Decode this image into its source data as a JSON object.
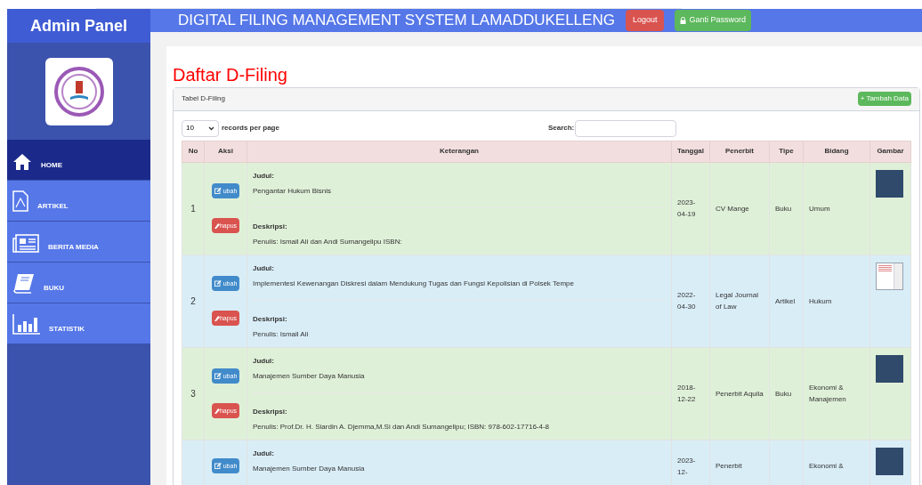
{
  "sidebar": {
    "title": "Admin Panel",
    "items": [
      {
        "label": "HOME",
        "selected": true
      },
      {
        "label": "ARTIKEL",
        "selected": false
      },
      {
        "label": "BERITA MEDIA",
        "selected": false
      },
      {
        "label": "BUKU",
        "selected": false
      },
      {
        "label": "STATISTIK",
        "selected": false
      }
    ]
  },
  "header": {
    "title": "DIGITAL FILING MANAGEMENT SYSTEM LAMADDUKELLENG",
    "logout": "Logout",
    "change_password": "Ganti Password"
  },
  "page_title": "Daftar D-Filing",
  "panel": {
    "title": "Tabel D-Filing",
    "add_button": "+ Tambah Data",
    "page_size": "10",
    "page_size_label": "records per page",
    "search_label": "Search:"
  },
  "table": {
    "columns": [
      "No",
      "Aksi",
      "Keterangan",
      "Tanggal",
      "Penerbit",
      "Tipe",
      "Bidang",
      "Gambar"
    ],
    "rows": [
      {
        "color": "#dff0d8",
        "no": "1",
        "edit": "ubah",
        "delete": "hapus",
        "title_label": "Judul:",
        "title": "Pengantar Hukum Bisnis",
        "desc_label": "Deskripsi:",
        "desc": "Penulis: Ismail Ali dan Andi Sumangelipu ISBN:",
        "date": "2023-04-19",
        "publisher": "CV Mange",
        "type": "Buku",
        "field": "Umum",
        "kind": "cover"
      },
      {
        "color": "#d9edf7",
        "no": "2",
        "edit": "ubah",
        "delete": "hapus",
        "title_label": "Judul:",
        "title": "Implementesi Kewenangan Diskresi dalam Mendukung Tugas dan Fungsi Kepolisian di Polsek Tempe",
        "desc_label": "Deskripsi:",
        "desc": "Penulis: Ismail Ali",
        "date": "2022-04-30",
        "publisher": "Legal Journal of Law",
        "type": "Artikel",
        "field": "Hukum",
        "kind": "document"
      },
      {
        "color": "#dff0d8",
        "no": "3",
        "edit": "ubah",
        "delete": "hapus",
        "title_label": "Judul:",
        "title": "Manajemen Sumber Daya Manusia",
        "desc_label": "Deskripsi:",
        "desc": "Penulis: Prof.Dr. H. Siardin A. Djemma,M.Si dan Andi Sumangelipu; ISBN: 978-602-17716-4-8",
        "date": "2018-12-22",
        "publisher": "Penerbit Aquila",
        "type": "Buku",
        "field": "Ekonomi & Manajemen",
        "kind": "cover"
      },
      {
        "color": "#d9edf7",
        "edit": "ubah",
        "title_label": "Judul:",
        "title": "Manajemen Sumber Daya Manusia",
        "date": "2023-12-",
        "publisher": "Penerbit",
        "field": "Ekonomi &",
        "kind": "cover"
      }
    ]
  }
}
